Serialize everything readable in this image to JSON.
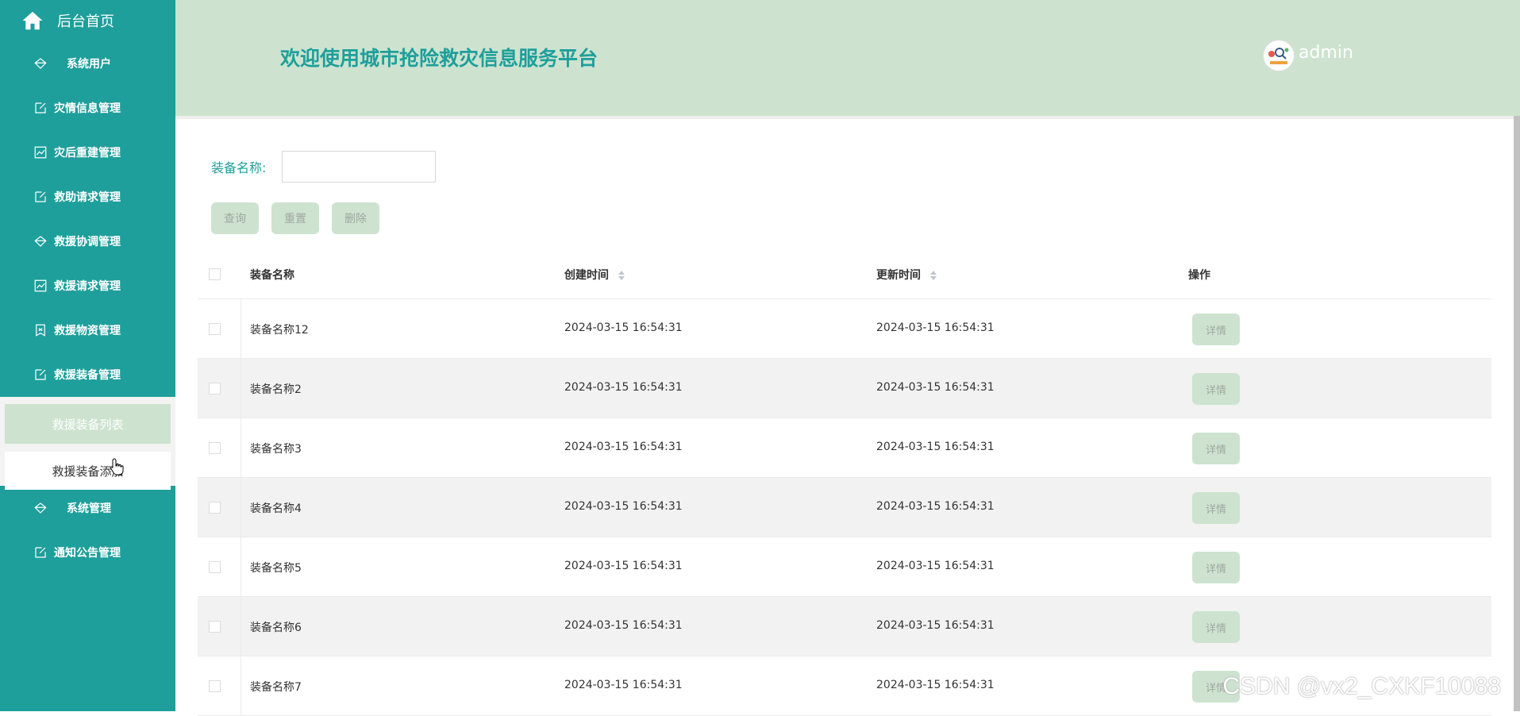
{
  "sidebar": {
    "home": {
      "icon": "home-icon",
      "label": "后台首页"
    },
    "items": [
      {
        "icon": "diamond-icon",
        "label": "系统用户"
      },
      {
        "icon": "edit-icon",
        "label": "灾情信息管理"
      },
      {
        "icon": "chart-icon",
        "label": "灾后重建管理"
      },
      {
        "icon": "edit-icon",
        "label": "救助请求管理"
      },
      {
        "icon": "diamond-icon",
        "label": "救援协调管理"
      },
      {
        "icon": "chart-icon",
        "label": "救援请求管理"
      },
      {
        "icon": "bookmark-icon",
        "label": "救援物资管理"
      },
      {
        "icon": "edit-icon",
        "label": "救援装备管理"
      }
    ],
    "submenu": [
      {
        "label": "救援装备列表",
        "active": true
      },
      {
        "label": "救援装备添加",
        "active": false
      }
    ],
    "items_after": [
      {
        "icon": "diamond-icon",
        "label": "系统管理"
      },
      {
        "icon": "edit-icon",
        "label": "通知公告管理"
      }
    ]
  },
  "header": {
    "title": "欢迎使用城市抢险救灾信息服务平台",
    "username": "admin"
  },
  "search": {
    "label": "装备名称:",
    "value": ""
  },
  "buttons": {
    "query": "查询",
    "reset": "重置",
    "delete": "删除"
  },
  "table": {
    "headers": {
      "name": "装备名称",
      "created": "创建时间",
      "updated": "更新时间",
      "action": "操作"
    },
    "rows": [
      {
        "name": "装备名称12",
        "created": "2024-03-15 16:54:31",
        "updated": "2024-03-15 16:54:31",
        "action": "详情"
      },
      {
        "name": "装备名称2",
        "created": "2024-03-15 16:54:31",
        "updated": "2024-03-15 16:54:31",
        "action": "详情"
      },
      {
        "name": "装备名称3",
        "created": "2024-03-15 16:54:31",
        "updated": "2024-03-15 16:54:31",
        "action": "详情"
      },
      {
        "name": "装备名称4",
        "created": "2024-03-15 16:54:31",
        "updated": "2024-03-15 16:54:31",
        "action": "详情"
      },
      {
        "name": "装备名称5",
        "created": "2024-03-15 16:54:31",
        "updated": "2024-03-15 16:54:31",
        "action": "详情"
      },
      {
        "name": "装备名称6",
        "created": "2024-03-15 16:54:31",
        "updated": "2024-03-15 16:54:31",
        "action": "详情"
      },
      {
        "name": "装备名称7",
        "created": "2024-03-15 16:54:31",
        "updated": "2024-03-15 16:54:31",
        "action": "详情"
      }
    ]
  },
  "watermark": "CSDN @vx2_CXKF10088",
  "colors": {
    "primary": "#1e9f9b",
    "header_bg": "#cde3cf",
    "button_bg": "#cde3cf"
  }
}
